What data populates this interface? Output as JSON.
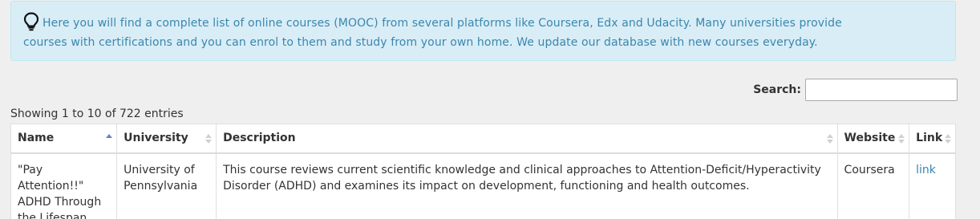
{
  "info": {
    "line1": "Here you will find a complete list of online courses (MOOC) from several platforms like Coursera, Edx and Udacity. Many universities provide",
    "line2": "courses with certifications and you can enrol to them and study from your own home. We update our database with new courses everyday."
  },
  "search": {
    "label": "Search:",
    "value": "",
    "placeholder": ""
  },
  "table_info": "Showing 1 to 10 of 722 entries",
  "columns": [
    "Name",
    "University",
    "Description",
    "Website",
    "Link"
  ],
  "rows": [
    {
      "name": "\"Pay Attention!!\" ADHD Through the Lifespan",
      "university": "University of Pennsylvania",
      "description": "This course reviews current scientific knowledge and clinical approaches to Attention-Deficit/Hyperactivity Disorder (ADHD) and examines its impact on development, functioning and health outcomes.",
      "website": "Coursera",
      "link": "link"
    }
  ],
  "colors": {
    "info_bg": "#d9edf7",
    "info_text": "#3a87ad",
    "link": "#3a87ad"
  },
  "icons": {
    "info": "lightbulb-icon",
    "sort_active": "sort-ascending-icon",
    "sort": "sort-both-icon"
  }
}
